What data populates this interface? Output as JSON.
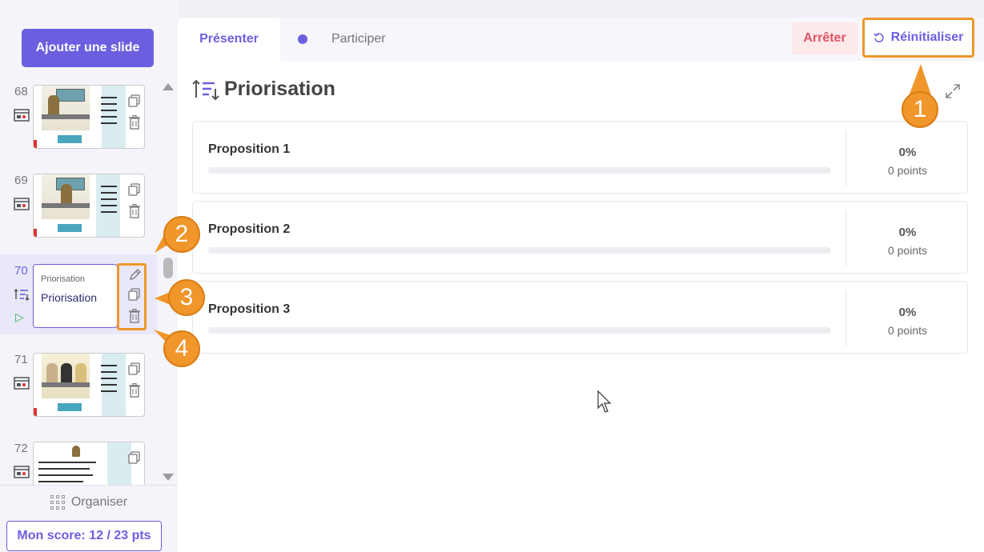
{
  "sidebar": {
    "add_slide_label": "Ajouter une slide",
    "slides": [
      {
        "number": "68"
      },
      {
        "number": "69"
      },
      {
        "number": "70",
        "title_small": "Priorisation",
        "title": "Priorisation"
      },
      {
        "number": "71"
      },
      {
        "number": "72"
      }
    ],
    "organise_label": "Organiser",
    "score_label": "Mon score: 12 / 23 pts"
  },
  "tabs": {
    "present_label": "Présenter",
    "participate_label": "Participer"
  },
  "actions": {
    "stop_label": "Arrêter",
    "reset_label": "Réinitialiser"
  },
  "main": {
    "title": "Priorisation",
    "propositions": [
      {
        "label": "Proposition 1",
        "percent": "0%",
        "points": "0 points",
        "progress": 0
      },
      {
        "label": "Proposition 2",
        "percent": "0%",
        "points": "0 points",
        "progress": 0
      },
      {
        "label": "Proposition 3",
        "percent": "0%",
        "points": "0 points",
        "progress": 0
      }
    ]
  },
  "callouts": [
    "1",
    "2",
    "3",
    "4"
  ],
  "colors": {
    "accent": "#6b5fe0",
    "callout": "#f0962a",
    "stop": "#e05565"
  }
}
